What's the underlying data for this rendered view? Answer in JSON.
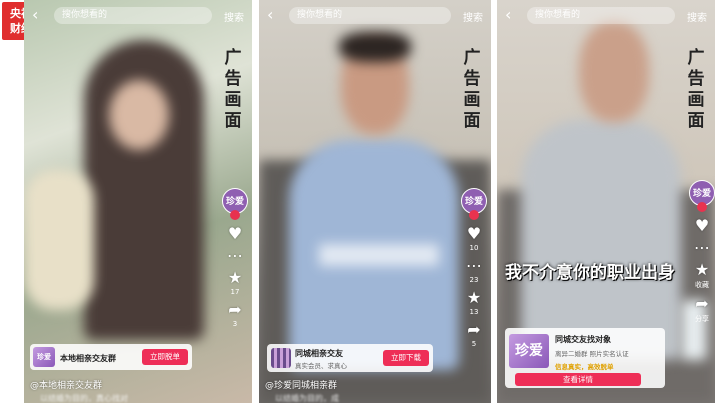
{
  "logo": {
    "line1": "央视",
    "line2": "财经"
  },
  "ad_tag": "广告画面",
  "panels": [
    {
      "search_placeholder": "搜你想看的",
      "search_button": "搜索",
      "avatar_text": "珍爱",
      "counts": [
        "17",
        "3"
      ],
      "card": {
        "brand": "珍爱",
        "title": "本地相亲交友群",
        "cta": "立即脱单"
      },
      "caption": "@本地相亲交友群",
      "caption_faded": "以结婚为目的，真心找对"
    },
    {
      "search_placeholder": "搜你想看的",
      "search_button": "搜索",
      "avatar_text": "珍爱",
      "counts": [
        "10",
        "23",
        "13",
        "5"
      ],
      "card": {
        "title": "同城相亲交友",
        "sub": "真实会员、求真心",
        "cta": "立即下载"
      },
      "caption": "@珍爱同城相亲群",
      "caption_faded": "以结婚为目的，成"
    },
    {
      "search_placeholder": "搜你想看的",
      "search_button": "搜索",
      "avatar_text": "珍爱",
      "subtitle": "我不介意你的职业出身",
      "counts": [
        "收藏",
        "分享"
      ],
      "card": {
        "brand": "珍爱",
        "title": "同城交友找对象",
        "tags": "离异二婚群  照片实名认证",
        "highlight": "信息真实，高效脱单",
        "cta": "查看详情"
      }
    }
  ]
}
